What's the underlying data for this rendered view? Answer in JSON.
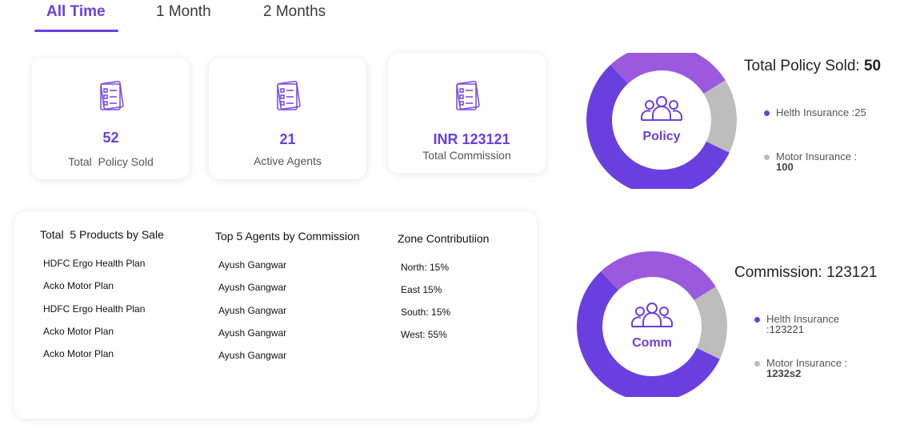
{
  "tabs": [
    {
      "label": "All Time",
      "active": true
    },
    {
      "label": "1 Month",
      "active": false
    },
    {
      "label": "2 Months",
      "active": false
    }
  ],
  "stats": [
    {
      "value": "52",
      "label": "Total  Policy Sold",
      "icon": "checklist-icon"
    },
    {
      "value": "21",
      "label": "Active Agents",
      "icon": "checklist-icon"
    },
    {
      "value": "INR 123121",
      "label": "Total Commission",
      "icon": "checklist-icon"
    }
  ],
  "lists": {
    "products": {
      "title": "Total  5 Products by Sale",
      "items": [
        "HDFC Ergo Health Plan",
        "Acko Motor Plan",
        "HDFC Ergo Health Plan",
        "Acko Motor Plan",
        "Acko Motor Plan"
      ]
    },
    "agents": {
      "title": "Top 5 Agents by Commission",
      "items": [
        "Ayush Gangwar",
        "Ayush Gangwar",
        "Ayush Gangwar",
        "Ayush Gangwar",
        "Ayush Gangwar"
      ]
    },
    "zones": {
      "title": "Zone Contributiion",
      "items": [
        "North: 15%",
        "East 15%",
        "South: 15%",
        "West: 55%"
      ]
    }
  },
  "policy_donut": {
    "title_prefix": "Total Policy Sold: ",
    "title_value": "50",
    "center_label": "Policy",
    "icon": "group-icon",
    "segments": [
      {
        "share": 0.56,
        "color": "#6a3fe0"
      },
      {
        "share": 0.28,
        "color": "#9b59dd"
      },
      {
        "share": 0.16,
        "color": "#bdbdbd"
      }
    ],
    "legend": [
      {
        "text": "Helth Insurance :25",
        "value": "",
        "color": "#6a3fe0"
      },
      {
        "text": "Motor Insurance :",
        "value": "100",
        "color": "#bdbdbd"
      }
    ]
  },
  "comm_donut": {
    "title": "Commission: 123121",
    "center_label": "Comm",
    "icon": "group-icon",
    "segments": [
      {
        "share": 0.56,
        "color": "#6a3fe0"
      },
      {
        "share": 0.28,
        "color": "#9b59dd"
      },
      {
        "share": 0.16,
        "color": "#bdbdbd"
      }
    ],
    "legend": [
      {
        "text": "Helth Insurance",
        "value": ":123221",
        "color": "#6a3fe0"
      },
      {
        "text": "Motor Insurance :",
        "value": "1232s2",
        "color": "#bdbdbd"
      }
    ]
  }
}
